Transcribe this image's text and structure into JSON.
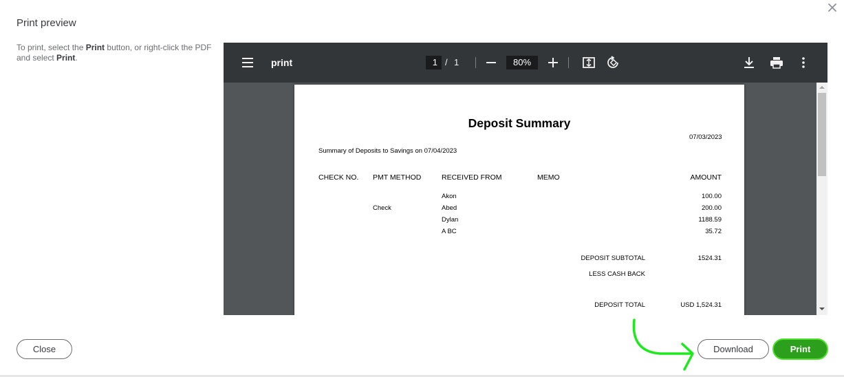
{
  "dialog": {
    "title": "Print preview",
    "instructions": {
      "part1": "To print, select the ",
      "bold1": "Print",
      "part2": " button, or right-click the PDF and select ",
      "bold2": "Print",
      "part3": "."
    }
  },
  "viewer": {
    "doc_title": "print",
    "page_current": "1",
    "page_separator": "/",
    "page_total": "1",
    "zoom": "80%"
  },
  "document": {
    "title": "Deposit Summary",
    "date": "07/03/2023",
    "subtitle": "Summary of Deposits to Savings on 07/04/2023",
    "columns": [
      "CHECK NO.",
      "PMT METHOD",
      "RECEIVED FROM",
      "MEMO",
      "AMOUNT"
    ],
    "rows": [
      {
        "check_no": "",
        "pmt_method": "",
        "received_from": "Akon",
        "memo": "",
        "amount": "100.00"
      },
      {
        "check_no": "",
        "pmt_method": "Check",
        "received_from": "Abed",
        "memo": "",
        "amount": "200.00"
      },
      {
        "check_no": "",
        "pmt_method": "",
        "received_from": "Dylan",
        "memo": "",
        "amount": "1188.59"
      },
      {
        "check_no": "",
        "pmt_method": "",
        "received_from": "A BC",
        "memo": "",
        "amount": "35.72"
      }
    ],
    "subtotal_label": "DEPOSIT SUBTOTAL",
    "subtotal_value": "1524.31",
    "cashback_label": "LESS CASH BACK",
    "total_label": "DEPOSIT TOTAL",
    "total_value": "USD 1,524.31"
  },
  "buttons": {
    "close": "Close",
    "download": "Download",
    "print": "Print"
  },
  "colors": {
    "primary_green": "#2ca01c",
    "annotation_green": "#1ee81e",
    "viewer_toolbar": "#323639",
    "viewer_background": "#525659"
  }
}
